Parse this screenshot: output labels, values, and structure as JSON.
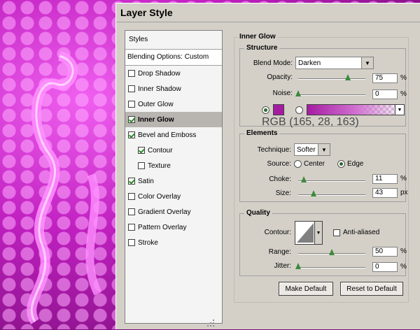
{
  "dialog": {
    "title": "Layer Style"
  },
  "styles_panel": {
    "header": "Styles",
    "blending_options": "Blending Options: Custom",
    "items": [
      {
        "label": "Drop Shadow",
        "checked": false
      },
      {
        "label": "Inner Shadow",
        "checked": false
      },
      {
        "label": "Outer Glow",
        "checked": false
      },
      {
        "label": "Inner Glow",
        "checked": true,
        "selected": true
      },
      {
        "label": "Bevel and Emboss",
        "checked": true
      },
      {
        "label": "Contour",
        "checked": true,
        "sub": true
      },
      {
        "label": "Texture",
        "checked": false,
        "sub": true
      },
      {
        "label": "Satin",
        "checked": true
      },
      {
        "label": "Color Overlay",
        "checked": false
      },
      {
        "label": "Gradient Overlay",
        "checked": false
      },
      {
        "label": "Pattern Overlay",
        "checked": false
      },
      {
        "label": "Stroke",
        "checked": false
      }
    ]
  },
  "inner_glow": {
    "title": "Inner Glow",
    "structure": {
      "title": "Structure",
      "blend_mode_label": "Blend Mode:",
      "blend_mode_value": "Darken",
      "opacity_label": "Opacity:",
      "opacity_value": "75",
      "noise_label": "Noise:",
      "noise_value": "0",
      "percent": "%",
      "color_rgb_label": "RGB (165, 28, 163)",
      "glow_color": "#a51ca3"
    },
    "elements": {
      "title": "Elements",
      "technique_label": "Technique:",
      "technique_value": "Softer",
      "source_label": "Source:",
      "source_center": "Center",
      "source_edge": "Edge",
      "choke_label": "Choke:",
      "choke_value": "11",
      "size_label": "Size:",
      "size_value": "43",
      "size_unit": "px"
    },
    "quality": {
      "title": "Quality",
      "contour_label": "Contour:",
      "anti_aliased_label": "Anti-aliased",
      "range_label": "Range:",
      "range_value": "50",
      "jitter_label": "Jitter:",
      "jitter_value": "0"
    },
    "buttons": {
      "make_default": "Make Default",
      "reset_default": "Reset to Default"
    }
  }
}
